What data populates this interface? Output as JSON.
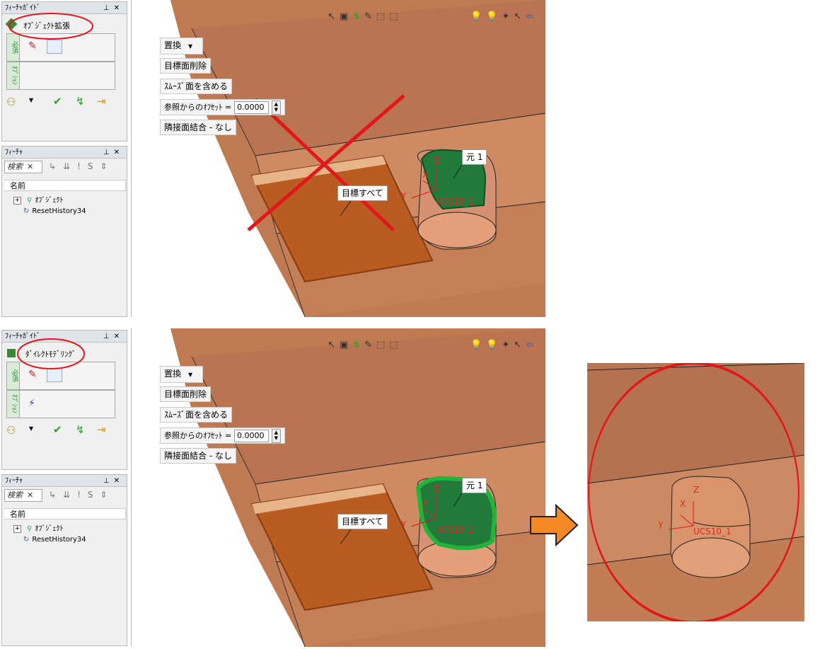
{
  "top": {
    "guide_panel": {
      "title": "ﾌｨｰﾁｬｶﾞｲﾄﾞ",
      "mode": "ｵﾌﾞｼﾞｪｸﾄ拡張",
      "required_tab": "必須",
      "option_tab": "ｵﾌﾟｼｮﾝ"
    },
    "feature_panel": {
      "title": "ﾌｨｰﾁｬ",
      "search_placeholder": "検索",
      "column_header": "名前",
      "tree": [
        "ｵﾌﾞｼﾞｪｸﾄ",
        "ResetHistory34"
      ]
    },
    "options": {
      "replace": "置換",
      "delete_target": "目標面削除",
      "include_smooth": "ｽﾑｰｽﾞ面を含める",
      "offset_label": "参照からのｵﾌｾｯﾄ =",
      "offset_value": "0.0000",
      "adjacent_merge": "隣接面結合 - なし"
    },
    "labels": {
      "source": "元 1",
      "target": "目標すべて",
      "ucs": "UCS10_1"
    }
  },
  "bottom": {
    "guide_panel": {
      "title": "ﾌｨｰﾁｬｶﾞｲﾄﾞ",
      "mode": "ﾀﾞｲﾚｸﾄﾓﾃﾞﾘﾝｸﾞ",
      "required_tab": "必須",
      "option_tab": "ｵﾌﾟｼｮﾝ"
    },
    "feature_panel": {
      "title": "ﾌｨｰﾁｬ",
      "search_placeholder": "検索",
      "column_header": "名前",
      "tree": [
        "ｵﾌﾞｼﾞｪｸﾄ",
        "ResetHistory34"
      ]
    },
    "options": {
      "replace": "置換",
      "delete_target": "目標面削除",
      "include_smooth": "ｽﾑｰｽﾞ面を含める",
      "offset_label": "参照からのｵﾌｾｯﾄ =",
      "offset_value": "0.0000",
      "adjacent_merge": "隣接面結合 - なし"
    },
    "labels": {
      "source": "元 1",
      "target": "目標すべて",
      "ucs": "UCS10_1"
    }
  },
  "result": {
    "axis_z": "Z",
    "axis_x": "X",
    "axis_y": "Y",
    "ucs": "UCS10_1"
  },
  "colors": {
    "model": "#c77d55",
    "model_dark": "#a95e34",
    "selection_green": "#1f7a3c",
    "highlight_red": "#e3161b",
    "arrow_orange": "#f58a24"
  },
  "icons": {
    "axis_x": "X",
    "axis_y": "Y",
    "axis_z": "Z",
    "pin": "⊥",
    "close": "✕",
    "check": "✔",
    "dropdown": "▼",
    "arrow_right": "➔"
  }
}
